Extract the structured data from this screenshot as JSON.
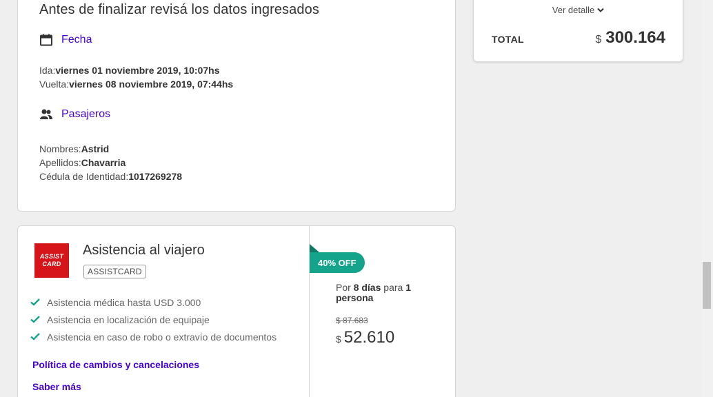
{
  "review": {
    "title": "Antes de finalizar revisá los datos ingresados",
    "fecha": {
      "label": "Fecha",
      "ida_label": "Ida:",
      "ida_value": "viernes 01 noviembre 2019, 10:07hs",
      "vuelta_label": "Vuelta:",
      "vuelta_value": "viernes 08 noviembre 2019, 07:44hs"
    },
    "pasajeros": {
      "label": "Pasajeros",
      "nombres_label": "Nombres:",
      "nombres_value": "Astrid",
      "apellidos_label": "Apellidos:",
      "apellidos_value": "Chavarria",
      "cedula_label": "Cédula de Identidad:",
      "cedula_value": "1017269278"
    }
  },
  "total": {
    "ver_detalle": "Ver detalle",
    "label": "TOTAL",
    "currency": "$",
    "amount": "300.164"
  },
  "assistance": {
    "logo_line1": "ASSIST",
    "logo_line2": "CARD",
    "title": "Asistencia al viajero",
    "provider": "ASSISTCARD",
    "benefits": [
      "Asistencia médica hasta USD 3.000",
      "Asistencia en localización de equipaje",
      "Asistencia en caso de robo o extravío de documentos"
    ],
    "policy_link": "Política de cambios y cancelaciones",
    "more_link": "Saber más",
    "offer": "40% OFF",
    "price_prefix": "Por",
    "days": "8 días",
    "para": "para",
    "persons": "1 persona",
    "old_price": "$ 87.683",
    "currency": "$",
    "new_price": "52.610"
  },
  "colors": {
    "accent": "#4300d2",
    "offer": "#14a38b",
    "check": "#14a38b",
    "logo_bg": "#d6151b"
  }
}
